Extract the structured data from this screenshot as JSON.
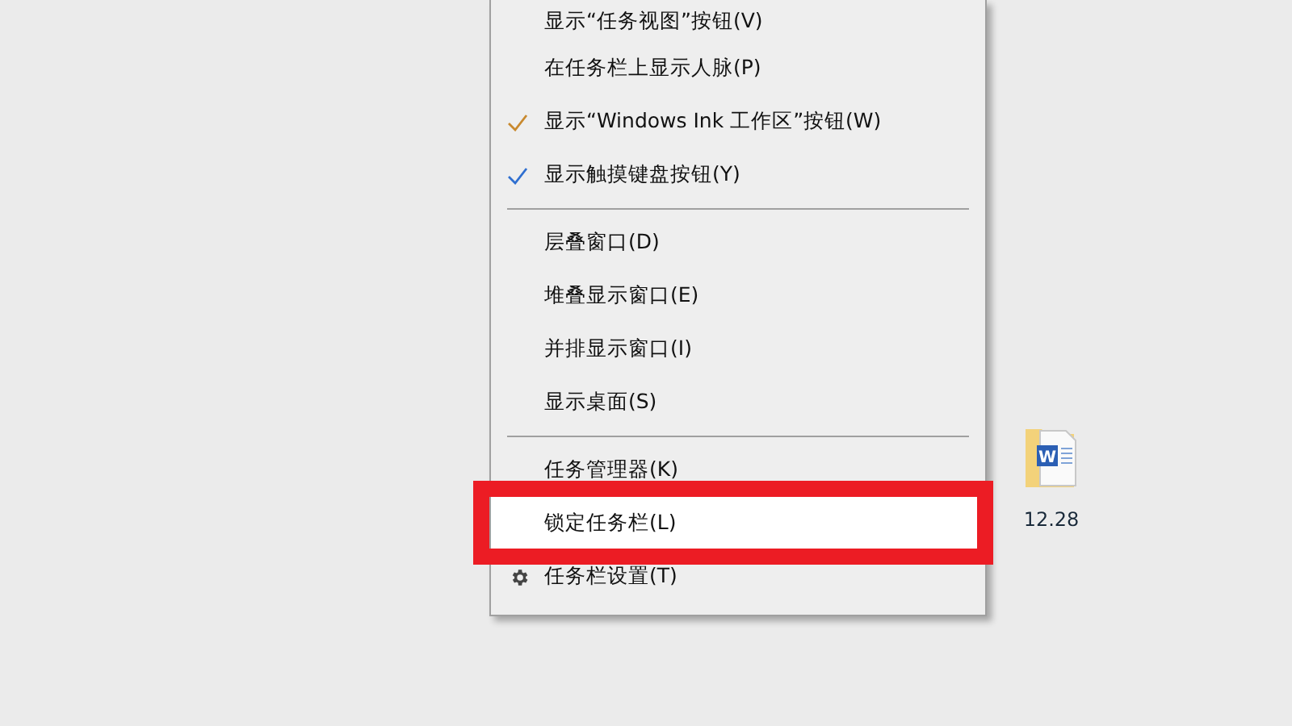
{
  "context_menu": {
    "items": [
      {
        "kind": "item",
        "label": "显示“任务视图”按钮(V)",
        "checked": false,
        "highlighted": false
      },
      {
        "kind": "item",
        "label": "在任务栏上显示人脉(P)",
        "checked": false,
        "highlighted": false
      },
      {
        "kind": "item",
        "label": "显示“Windows Ink 工作区”按钮(W)",
        "checked": true,
        "color": "#c8892e",
        "highlighted": false
      },
      {
        "kind": "item",
        "label": "显示触摸键盘按钮(Y)",
        "checked": true,
        "color": "#2f6fd0",
        "highlighted": false
      },
      {
        "kind": "separator"
      },
      {
        "kind": "item",
        "label": "层叠窗口(D)",
        "checked": false,
        "highlighted": false
      },
      {
        "kind": "item",
        "label": "堆叠显示窗口(E)",
        "checked": false,
        "highlighted": false
      },
      {
        "kind": "item",
        "label": "并排显示窗口(I)",
        "checked": false,
        "highlighted": false
      },
      {
        "kind": "item",
        "label": "显示桌面(S)",
        "checked": false,
        "highlighted": false
      },
      {
        "kind": "separator"
      },
      {
        "kind": "item",
        "label": "任务管理器(K)",
        "checked": false,
        "highlighted": false
      },
      {
        "kind": "item",
        "label": "锁定任务栏(L)",
        "checked": false,
        "highlighted": true
      },
      {
        "kind": "settings_item",
        "label": "任务栏设置(T)",
        "checked": false,
        "highlighted": false
      }
    ]
  },
  "desktop_icon": {
    "label": "12.28",
    "badge_letter": "W"
  }
}
